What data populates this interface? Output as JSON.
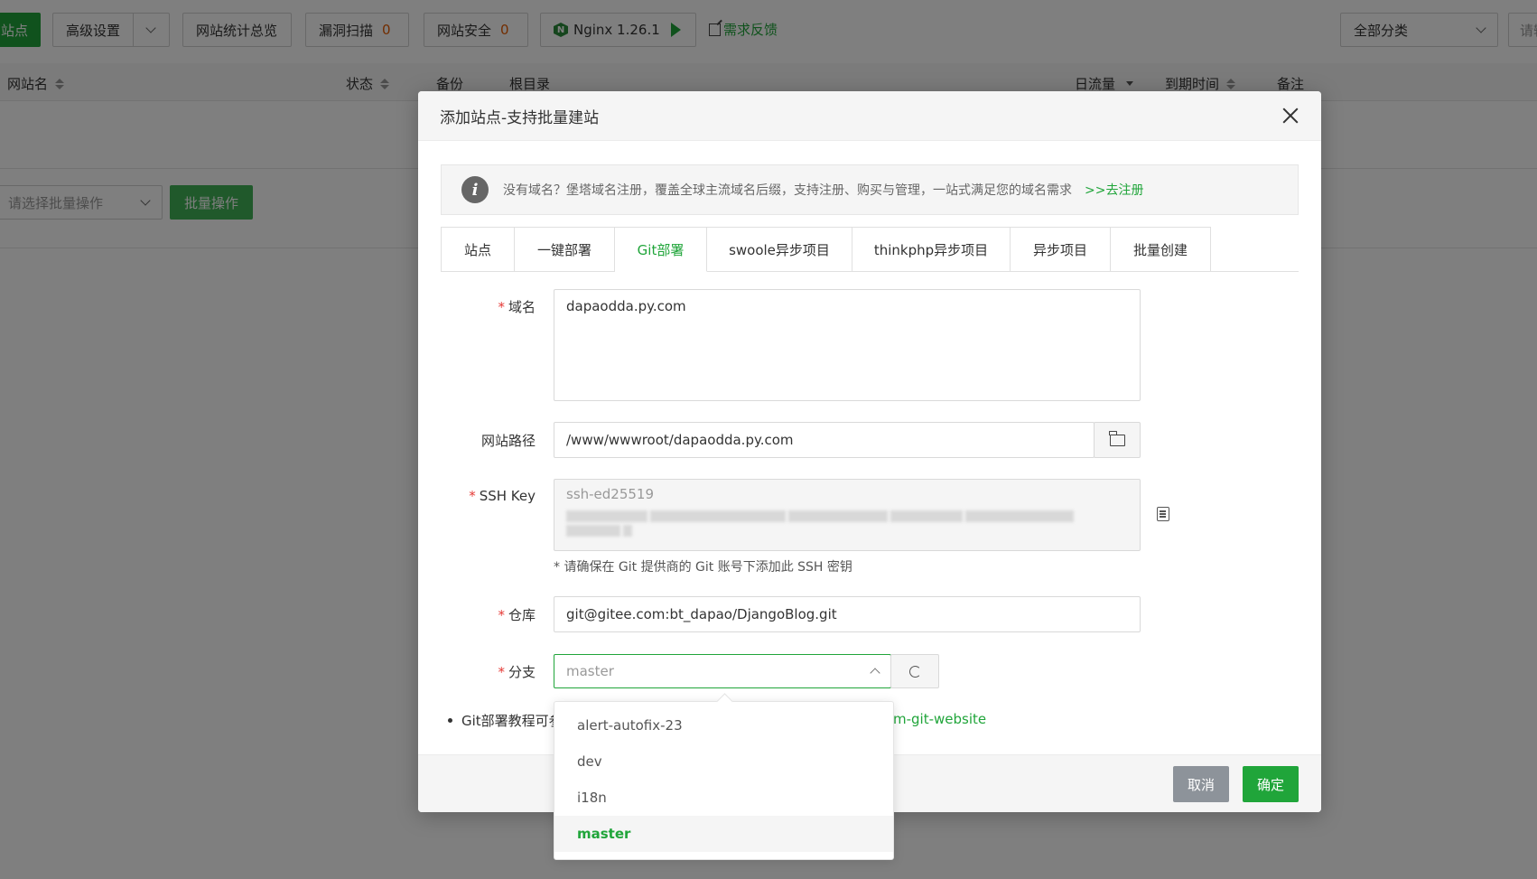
{
  "toolbar": {
    "add_site_label": "站点",
    "advanced_settings_label": "高级设置",
    "site_stats_label": "网站统计总览",
    "vuln_scan_label": "漏洞扫描",
    "vuln_scan_count": "0",
    "site_security_label": "网站安全",
    "site_security_count": "0",
    "nginx_label": "Nginx 1.26.1",
    "feedback_label": "需求反馈",
    "category_select_value": "全部分类",
    "search_placeholder": "请输"
  },
  "table": {
    "columns": [
      "网站名",
      "状态",
      "备份",
      "根目录",
      "日流量",
      "到期时间",
      "备注"
    ]
  },
  "batch": {
    "select_placeholder": "请选择批量操作",
    "button_label": "批量操作"
  },
  "modal": {
    "title": "添加站点-支持批量建站",
    "notice_text": "没有域名？堡塔域名注册，覆盖全球主流域名后缀，支持注册、购买与管理，一站式满足您的域名需求",
    "notice_link": ">>去注册",
    "tabs": [
      "站点",
      "一键部署",
      "Git部署",
      "swoole异步项目",
      "thinkphp异步项目",
      "异步项目",
      "批量创建"
    ],
    "active_tab": "Git部署",
    "form": {
      "domain_label": "域名",
      "domain_value": "dapaodda.py.com",
      "path_label": "网站路径",
      "path_value": "/www/wwwroot/dapaodda.py.com",
      "ssh_label": "SSH Key",
      "ssh_key_prefix": "ssh-ed25519",
      "ssh_tip": "* 请确保在 Git 提供商的 Git 账号下添加此 SSH 密钥",
      "repo_label": "仓库",
      "repo_value": "git@gitee.com:bt_dapao/DjangoBlog.git",
      "branch_label": "分支",
      "branch_value": "master"
    },
    "tutorial_text": "Git部署教程可参",
    "tutorial_link": "m-git-website",
    "cancel_label": "取消",
    "confirm_label": "确定",
    "branch_options": [
      "alert-autofix-23",
      "dev",
      "i18n",
      "master"
    ],
    "selected_branch": "master"
  },
  "colors": {
    "accent": "#20a53a",
    "count": "#e45a00",
    "cancel": "#8d939a"
  }
}
